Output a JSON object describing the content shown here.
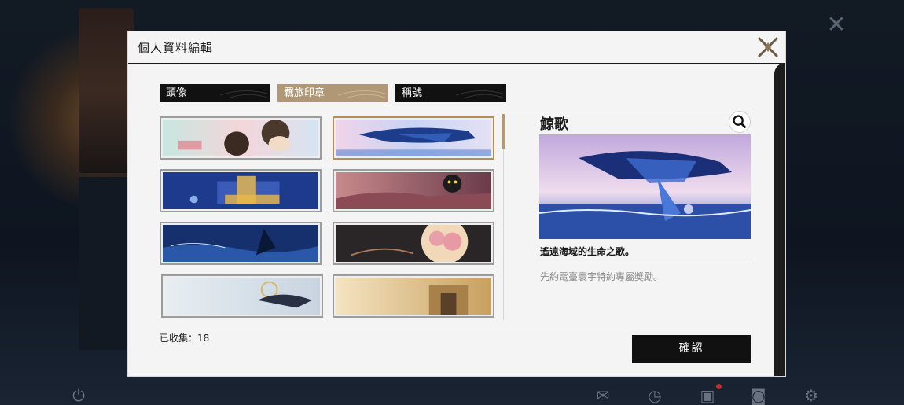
{
  "modal": {
    "title": "個人資料編輯"
  },
  "tabs": [
    {
      "label": "頭像",
      "active": false
    },
    {
      "label": "羈旅印章",
      "active": true
    },
    {
      "label": "稱號",
      "active": false
    }
  ],
  "stamps": [
    {
      "theme": "pastel-characters",
      "selected": false
    },
    {
      "theme": "whale",
      "selected": true
    },
    {
      "theme": "blue-palace",
      "selected": false
    },
    {
      "theme": "black-cat-crimson",
      "selected": false
    },
    {
      "theme": "ocean-butterfly",
      "selected": false
    },
    {
      "theme": "cherry-blossom-moon",
      "selected": false
    },
    {
      "theme": "white-dragon",
      "selected": false
    },
    {
      "theme": "golden-city",
      "selected": false
    }
  ],
  "detail": {
    "name": "鯨歌",
    "description": "遙遠海域的生命之歌。",
    "source": "先約電臺寰宇特約專屬獎勵。"
  },
  "footer": {
    "collected": "已收集：18",
    "confirm_label": "確認"
  },
  "colors": {
    "accent_gold": "#b09876",
    "selected_border": "#b58f52",
    "dark": "#111111"
  }
}
